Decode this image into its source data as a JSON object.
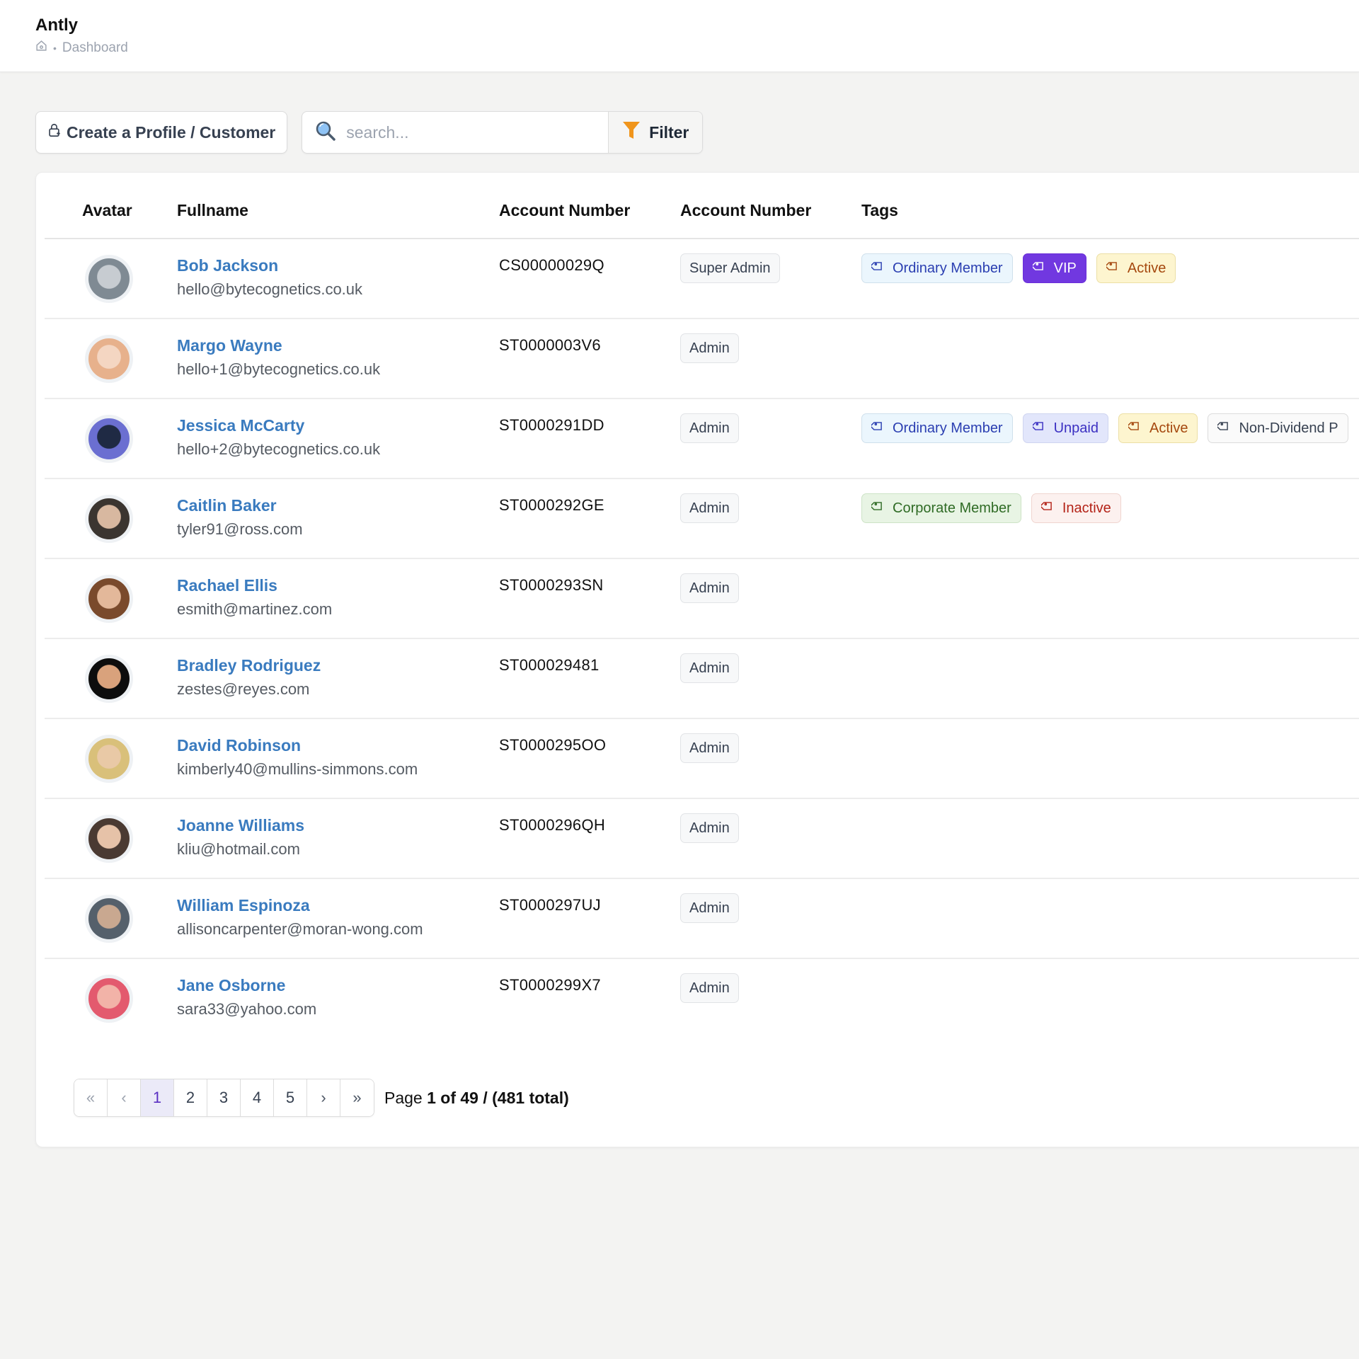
{
  "app": {
    "title": "Antly",
    "breadcrumb": {
      "home_icon": "home-icon",
      "separator": "•",
      "current": "Dashboard"
    }
  },
  "toolbar": {
    "create_label": "Create a Profile / Customer",
    "create_icon": "user-lock-icon",
    "search_icon": "magnifying-glass-icon",
    "search_placeholder": "search...",
    "search_value": "",
    "filter_label": "Filter",
    "filter_icon": "funnel-icon",
    "filter_color": "#f0951c"
  },
  "table": {
    "columns": [
      "Avatar",
      "Fullname",
      "Account Number",
      "Account Number",
      "Tags"
    ],
    "rows": [
      {
        "name": "Bob Jackson",
        "email": "hello@bytecognetics.co.uk",
        "account": "CS00000029Q",
        "role": "Super Admin",
        "avatar_colors": [
          "#7f8a93",
          "#c7ccd1"
        ],
        "tags": [
          {
            "label": "Ordinary Member",
            "style": "ordinary"
          },
          {
            "label": "VIP",
            "style": "vip"
          },
          {
            "label": "Active",
            "style": "active"
          }
        ]
      },
      {
        "name": "Margo Wayne",
        "email": "hello+1@bytecognetics.co.uk",
        "account": "ST0000003V6",
        "role": "Admin",
        "avatar_colors": [
          "#e7b18c",
          "#f4d6c2"
        ],
        "tags": []
      },
      {
        "name": "Jessica McCarty",
        "email": "hello+2@bytecognetics.co.uk",
        "account": "ST0000291DD",
        "role": "Admin",
        "avatar_colors": [
          "#6b6fd1",
          "#1f2a44"
        ],
        "tags": [
          {
            "label": "Ordinary Member",
            "style": "ordinary"
          },
          {
            "label": "Unpaid",
            "style": "unpaid"
          },
          {
            "label": "Active",
            "style": "active"
          },
          {
            "label": "Non-Dividend P",
            "style": "nondividend"
          }
        ]
      },
      {
        "name": "Caitlin Baker",
        "email": "tyler91@ross.com",
        "account": "ST0000292GE",
        "role": "Admin",
        "avatar_colors": [
          "#3b3530",
          "#d8b8a0"
        ],
        "tags": [
          {
            "label": "Corporate Member",
            "style": "corporate"
          },
          {
            "label": "Inactive",
            "style": "inactive"
          }
        ]
      },
      {
        "name": "Rachael Ellis",
        "email": "esmith@martinez.com",
        "account": "ST0000293SN",
        "role": "Admin",
        "avatar_colors": [
          "#7a4a2c",
          "#e3b89a"
        ],
        "tags": []
      },
      {
        "name": "Bradley Rodriguez",
        "email": "zestes@reyes.com",
        "account": "ST000029481",
        "role": "Admin",
        "avatar_colors": [
          "#0d0d0d",
          "#d9a27c"
        ],
        "tags": []
      },
      {
        "name": "David Robinson",
        "email": "kimberly40@mullins-simmons.com",
        "account": "ST0000295OO",
        "role": "Admin",
        "avatar_colors": [
          "#d9c07a",
          "#e9c9a6"
        ],
        "tags": []
      },
      {
        "name": "Joanne Williams",
        "email": "kliu@hotmail.com",
        "account": "ST0000296QH",
        "role": "Admin",
        "avatar_colors": [
          "#4a3a32",
          "#e6c2a8"
        ],
        "tags": []
      },
      {
        "name": "William Espinoza",
        "email": "allisoncarpenter@moran-wong.com",
        "account": "ST0000297UJ",
        "role": "Admin",
        "avatar_colors": [
          "#55606b",
          "#c9a890"
        ],
        "tags": []
      },
      {
        "name": "Jane Osborne",
        "email": "sara33@yahoo.com",
        "account": "ST0000299X7",
        "role": "Admin",
        "avatar_colors": [
          "#e35a6e",
          "#f2b3a8"
        ],
        "tags": []
      }
    ]
  },
  "pagination": {
    "first": "«",
    "prev": "‹",
    "next": "›",
    "last": "»",
    "pages": [
      "1",
      "2",
      "3",
      "4",
      "5"
    ],
    "current_page": "1",
    "info_prefix": "Page ",
    "info_bold": "1 of 49 / (481 total)"
  }
}
